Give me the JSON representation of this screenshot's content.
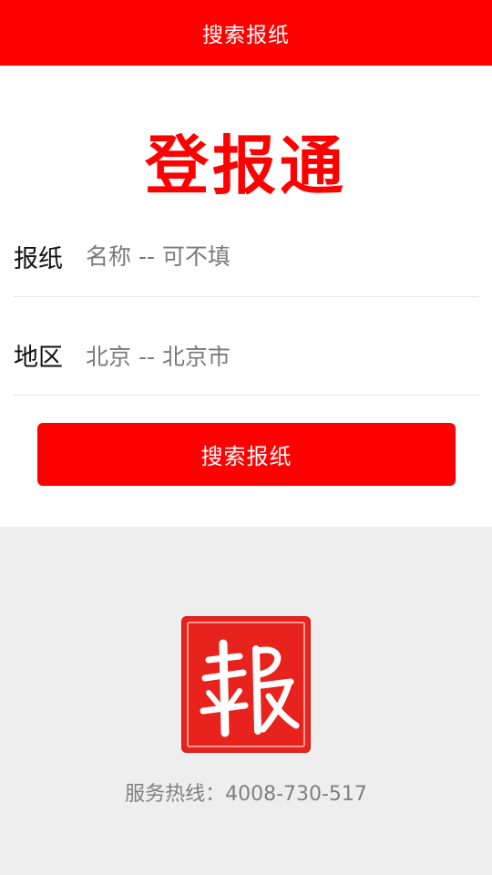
{
  "header": {
    "title": "搜索报纸"
  },
  "brand": {
    "title": "登报通"
  },
  "form": {
    "newspaper": {
      "label": "报纸",
      "placeholder": "名称 -- 可不填"
    },
    "region": {
      "label": "地区",
      "value": "北京 -- 北京市"
    }
  },
  "search_button": {
    "label": "搜索报纸"
  },
  "footer": {
    "seal_glyph": "報",
    "hotline_label": "服务热线：",
    "hotline_number": "4008-730-517"
  },
  "colors": {
    "accent": "#ff0000",
    "background_light": "#eeeeee",
    "text_muted": "#7a7a7a"
  }
}
